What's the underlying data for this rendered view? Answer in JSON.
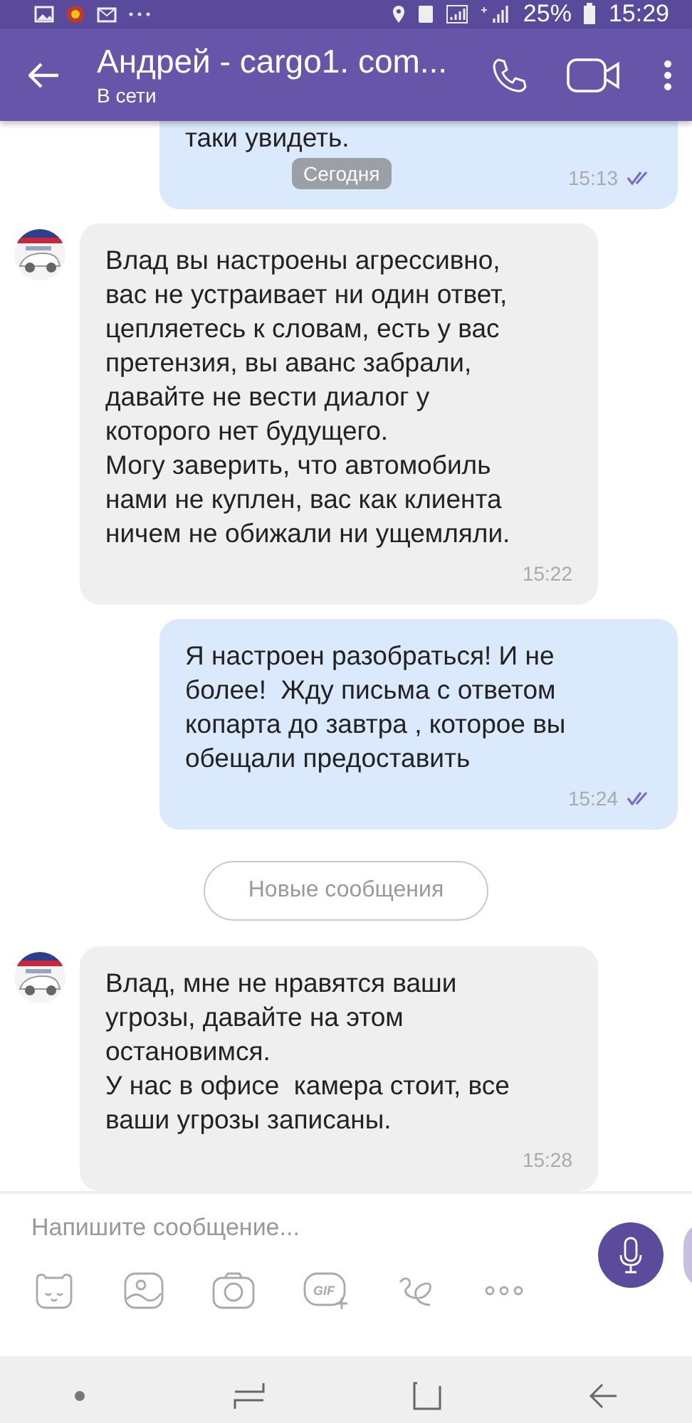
{
  "status_bar": {
    "battery": "25%",
    "time": "15:29"
  },
  "header": {
    "title": "Андрей - cargo1. com...",
    "subtitle": "В сети"
  },
  "messages": [
    {
      "kind": "outgoing",
      "text": "таки увидеть.",
      "time": "15:13",
      "read": true
    },
    {
      "kind": "date",
      "text": "Сегодня"
    },
    {
      "kind": "incoming",
      "text": "Влад вы настроены агрессивно,\nвас не устраивает ни один ответ,\nцепляетесь к словам, есть у вас\nпретензия, вы аванс забрали,\nдавайте не вести диалог у\nкоторого нет будущего.\nМогу заверить, что автомобиль\nнами не куплен, вас как клиента\nничем не обижали ни ущемляли.",
      "time": "15:22"
    },
    {
      "kind": "outgoing",
      "text": "Я настроен разобраться! И не\nболее!  Жду письма с ответом\nкопарта до завтра , которое вы\nобещали предоставить",
      "time": "15:24",
      "read": true
    },
    {
      "kind": "new_divider",
      "text": "Новые сообщения"
    },
    {
      "kind": "incoming",
      "text": "Влад, мне не нравятся ваши\nугрозы, давайте на этом\nостановимся.\nУ нас в офисе  камера стоит, все\nваши угрозы записаны.",
      "time": "15:28"
    }
  ],
  "composer": {
    "placeholder": "Напишите сообщение...",
    "gif_label": "GIF"
  }
}
